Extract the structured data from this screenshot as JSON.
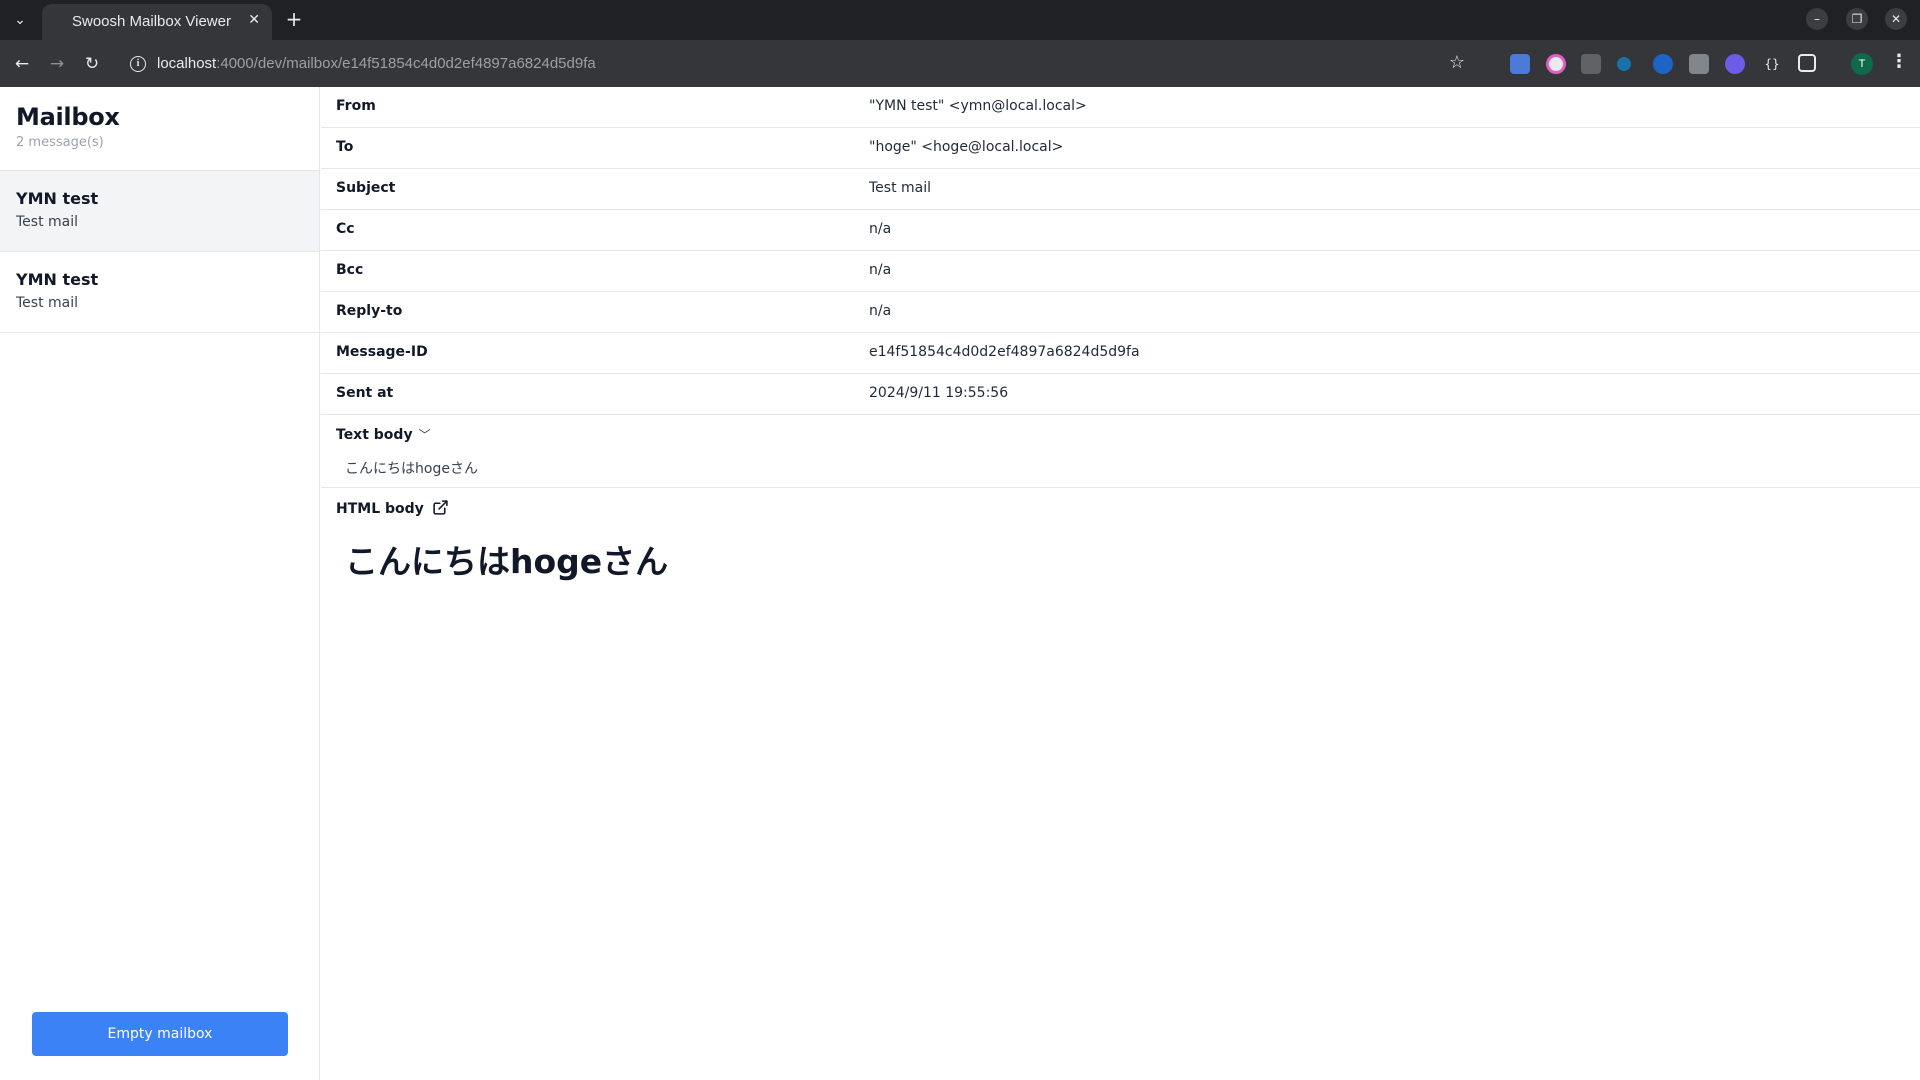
{
  "browser": {
    "tab_title": "Swoosh Mailbox Viewer",
    "url_host": "localhost",
    "url_path": ":4000/dev/mailbox/e14f51854c4d0d2ef4897a6824d5d9fa",
    "profile_initial": "T"
  },
  "sidebar": {
    "title": "Mailbox",
    "count": "2 message(s)",
    "messages": [
      {
        "from": "YMN test",
        "subject": "Test mail",
        "active": true
      },
      {
        "from": "YMN test",
        "subject": "Test mail",
        "active": false
      }
    ],
    "empty_label": "Empty mailbox"
  },
  "headers": [
    {
      "label": "From",
      "value": "\"YMN test\" <ymn@local.local>"
    },
    {
      "label": "To",
      "value": "\"hoge\" <hoge@local.local>"
    },
    {
      "label": "Subject",
      "value": "Test mail"
    },
    {
      "label": "Cc",
      "value": "n/a"
    },
    {
      "label": "Bcc",
      "value": "n/a"
    },
    {
      "label": "Reply-to",
      "value": "n/a"
    },
    {
      "label": "Message-ID",
      "value": "e14f51854c4d0d2ef4897a6824d5d9fa"
    },
    {
      "label": "Sent at",
      "value": "2024/9/11 19:55:56"
    }
  ],
  "text_body": {
    "title": "Text body",
    "content": "こんにちはhogeさん"
  },
  "html_body": {
    "title": "HTML body",
    "content": "こんにちはhogeさん"
  },
  "colors": {
    "primary_button": "#3b82f6",
    "active_row": "#f3f4f6",
    "border": "#e5e7eb"
  }
}
